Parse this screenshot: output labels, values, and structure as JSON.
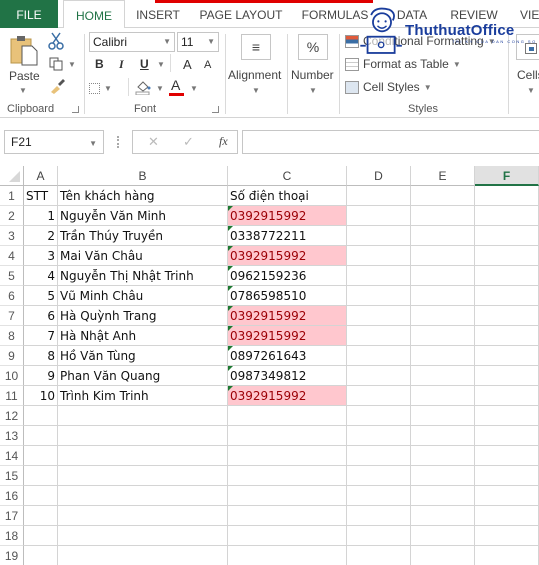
{
  "ribbon_tabs": [
    "FILE",
    "HOME",
    "INSERT",
    "PAGE LAYOUT",
    "FORMULAS",
    "DATA",
    "REVIEW",
    "VIEW"
  ],
  "active_tab": "HOME",
  "clipboard": {
    "paste_label": "Paste",
    "group_label": "Clipboard",
    "icons": [
      "paste-icon",
      "cut-icon",
      "copy-icon",
      "format-painter-icon"
    ]
  },
  "font": {
    "font_name": "Calibri",
    "font_size": "11",
    "bold": "B",
    "italic": "I",
    "underline": "U",
    "grow": "A",
    "shrink": "A",
    "font_color_glyph": "A",
    "font_color": "#e00000",
    "group_label": "Font"
  },
  "alignment": {
    "label": "Alignment",
    "glyph": "≡"
  },
  "number": {
    "label": "Number",
    "glyph": "%"
  },
  "styles": {
    "conditional_formatting": "Conditional Formatting",
    "format_as_table": "Format as Table",
    "cell_styles": "Cell Styles",
    "group_label": "Styles"
  },
  "cells": {
    "label": "Cells"
  },
  "watermark": {
    "text": "ThuthuatOffice",
    "sub": "TRI KY CUA DAN CONG SO"
  },
  "formula_bar": {
    "name_box": "F21",
    "cancel_glyph": "✕",
    "enter_glyph": "✓",
    "fx_glyph": "fx",
    "formula_value": ""
  },
  "sheet": {
    "columns": [
      "A",
      "B",
      "C",
      "D",
      "E",
      "F"
    ],
    "selected_column": "F",
    "row_numbers": [
      "1",
      "2",
      "3",
      "4",
      "5",
      "6",
      "7",
      "8",
      "9",
      "10",
      "11",
      "12",
      "13",
      "14",
      "15",
      "16",
      "17",
      "18",
      "19"
    ],
    "header": {
      "stt": "STT",
      "name": "Tên khách hàng",
      "phone": "Số điện thoại"
    },
    "rows": [
      {
        "stt": "1",
        "name": "Nguyễn Văn Minh",
        "phone": "0392915992",
        "duplicate": true
      },
      {
        "stt": "2",
        "name": "Trần Thúy Truyền",
        "phone": "0338772211",
        "duplicate": false
      },
      {
        "stt": "3",
        "name": "Mai Văn Châu",
        "phone": "0392915992",
        "duplicate": true
      },
      {
        "stt": "4",
        "name": "Nguyễn Thị Nhật Trinh",
        "phone": "0962159236",
        "duplicate": false
      },
      {
        "stt": "5",
        "name": "Vũ Minh Châu",
        "phone": "0786598510",
        "duplicate": false
      },
      {
        "stt": "6",
        "name": "Hà Quỳnh Trang",
        "phone": "0392915992",
        "duplicate": true
      },
      {
        "stt": "7",
        "name": "Hà Nhật Anh",
        "phone": "0392915992",
        "duplicate": true
      },
      {
        "stt": "8",
        "name": "Hồ Văn Tùng",
        "phone": "0897261643",
        "duplicate": false
      },
      {
        "stt": "9",
        "name": "Phan Văn Quang",
        "phone": "0987349812",
        "duplicate": false
      },
      {
        "stt": "10",
        "name": "Trình Kim Trinh",
        "phone": "0392915992",
        "duplicate": true
      }
    ],
    "duplicate_fill": "#ffc7ce",
    "duplicate_text": "#9c0006"
  }
}
